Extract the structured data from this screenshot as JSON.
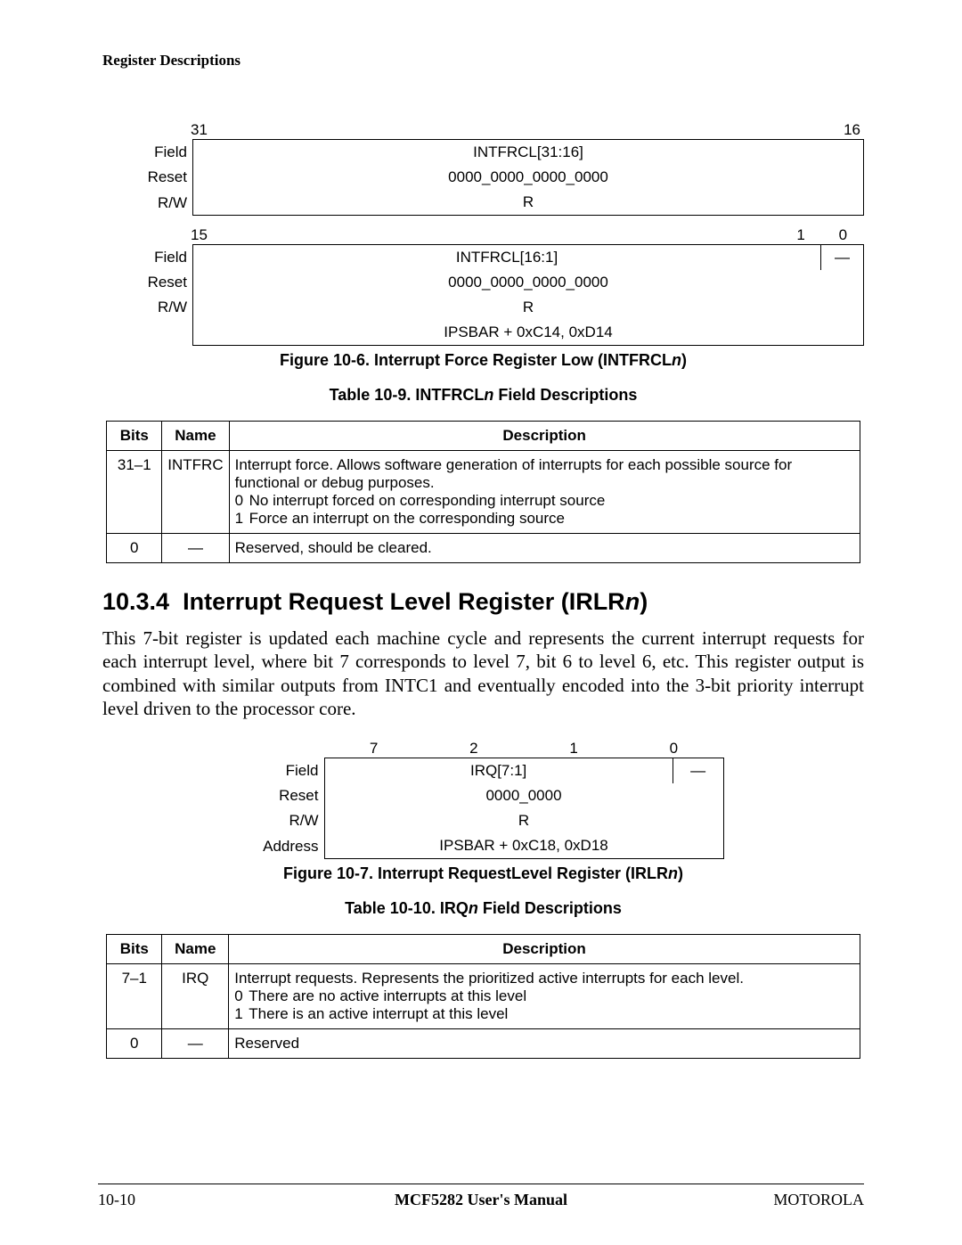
{
  "header": {
    "section_title": "Register Descriptions"
  },
  "intfrcl_fig": {
    "bit_hi_left": "31",
    "bit_hi_right": "16",
    "field_label": "Field",
    "reset_label": "Reset",
    "rw_label": "R/W",
    "field_hi": "INTFRCL[31:16]",
    "reset_hi": "0000_0000_0000_0000",
    "rw_hi": "R",
    "bit_lo_left": "15",
    "bit_lo_1": "1",
    "bit_lo_0": "0",
    "field_lo": "INTFRCL[16:1]",
    "field_lo_dash": "—",
    "reset_lo": "0000_0000_0000_0000",
    "rw_lo": "R",
    "addr": "IPSBAR + 0xC14, 0xD14",
    "caption_prefix": "Figure 10-6. Interrupt Force Register Low (INTFRCL",
    "caption_suffix": ")",
    "caption_n": "n"
  },
  "intfrcl_table": {
    "caption_prefix": "Table 10-9. INTFRCL",
    "caption_n": "n",
    "caption_suffix": " Field Descriptions",
    "h_bits": "Bits",
    "h_name": "Name",
    "h_desc": "Description",
    "rows": [
      {
        "bits": "31–1",
        "name": "INTFRC",
        "desc_main": "Interrupt force. Allows software generation of interrupts for each possible source for functional or debug purposes.",
        "opt0_n": "0",
        "opt0_t": "No interrupt forced on corresponding interrupt source",
        "opt1_n": "1",
        "opt1_t": "Force an interrupt on the corresponding source"
      },
      {
        "bits": "0",
        "name": "—",
        "desc_main": "Reserved, should be cleared."
      }
    ]
  },
  "irlr_section": {
    "num": "10.3.4",
    "title_prefix": "Interrupt Request Level Register (IRLR",
    "title_n": "n",
    "title_suffix": ")",
    "body": "This 7-bit register is updated each machine cycle and represents the current interrupt requests for each interrupt level, where bit 7 corresponds to level 7, bit 6 to level 6, etc. This register output is combined with similar outputs from INTC1 and eventually encoded into the 3-bit priority interrupt level driven to the processor core."
  },
  "irlr_fig": {
    "bit7": "7",
    "bit2": "2",
    "bit1": "1",
    "bit0": "0",
    "field_label": "Field",
    "reset_label": "Reset",
    "rw_label": "R/W",
    "addr_label": "Address",
    "field_big": "IRQ[7:1]",
    "field_sm": "—",
    "reset": "0000_0000",
    "rw": "R",
    "addr": "IPSBAR + 0xC18, 0xD18",
    "caption_prefix": "Figure 10-7. Interrupt RequestLevel Register (IRLR",
    "caption_n": "n",
    "caption_suffix": ")"
  },
  "irq_table": {
    "caption_prefix": "Table 10-10. IRQ",
    "caption_n": "n",
    "caption_suffix": " Field Descriptions",
    "h_bits": "Bits",
    "h_name": "Name",
    "h_desc": "Description",
    "rows": [
      {
        "bits": "7–1",
        "name": "IRQ",
        "desc_main": "Interrupt requests. Represents the prioritized active interrupts for each level.",
        "opt0_n": "0",
        "opt0_t": "There are no active interrupts at this level",
        "opt1_n": "1",
        "opt1_t": "There is an active interrupt at this level"
      },
      {
        "bits": "0",
        "name": "—",
        "desc_main": "Reserved"
      }
    ]
  },
  "footer": {
    "left": "10-10",
    "center": "MCF5282 User's Manual",
    "right": "MOTOROLA"
  }
}
